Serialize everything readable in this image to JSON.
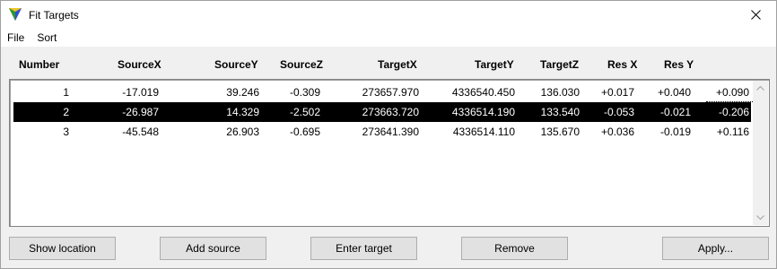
{
  "window": {
    "title": "Fit Targets"
  },
  "menu": [
    "File",
    "Sort"
  ],
  "columns": [
    "Number",
    "SourceX",
    "SourceY",
    "SourceZ",
    "TargetX",
    "TargetY",
    "TargetZ",
    "Res X",
    "Res Y"
  ],
  "rows": [
    {
      "number": "1",
      "source_x": "-17.019",
      "source_y": "39.246",
      "source_z": "-0.309",
      "target_x": "273657.970",
      "target_y": "4336540.450",
      "target_z": "136.030",
      "res_x": "+0.017",
      "res_y": "+0.040",
      "res": "+0.090",
      "selected": false
    },
    {
      "number": "2",
      "source_x": "-26.987",
      "source_y": "14.329",
      "source_z": "-2.502",
      "target_x": "273663.720",
      "target_y": "4336514.190",
      "target_z": "133.540",
      "res_x": "-0.053",
      "res_y": "-0.021",
      "res": "-0.206",
      "selected": true
    },
    {
      "number": "3",
      "source_x": "-45.548",
      "source_y": "26.903",
      "source_z": "-0.695",
      "target_x": "273641.390",
      "target_y": "4336514.110",
      "target_z": "135.670",
      "res_x": "+0.036",
      "res_y": "-0.019",
      "res": "+0.116",
      "selected": false
    }
  ],
  "buttons": {
    "show_location": "Show location",
    "add_source": "Add source",
    "enter_target": "Enter target",
    "remove": "Remove",
    "apply": "Apply..."
  },
  "icons": {
    "app": "fit-targets-app-icon",
    "close": "close-icon",
    "scroll_up": "scroll-up-arrow-icon",
    "scroll_down": "scroll-down-arrow-icon"
  },
  "colors": {
    "selection_bg": "#000000",
    "selection_text": "#ffffff",
    "button_bg": "#e1e1e1"
  }
}
